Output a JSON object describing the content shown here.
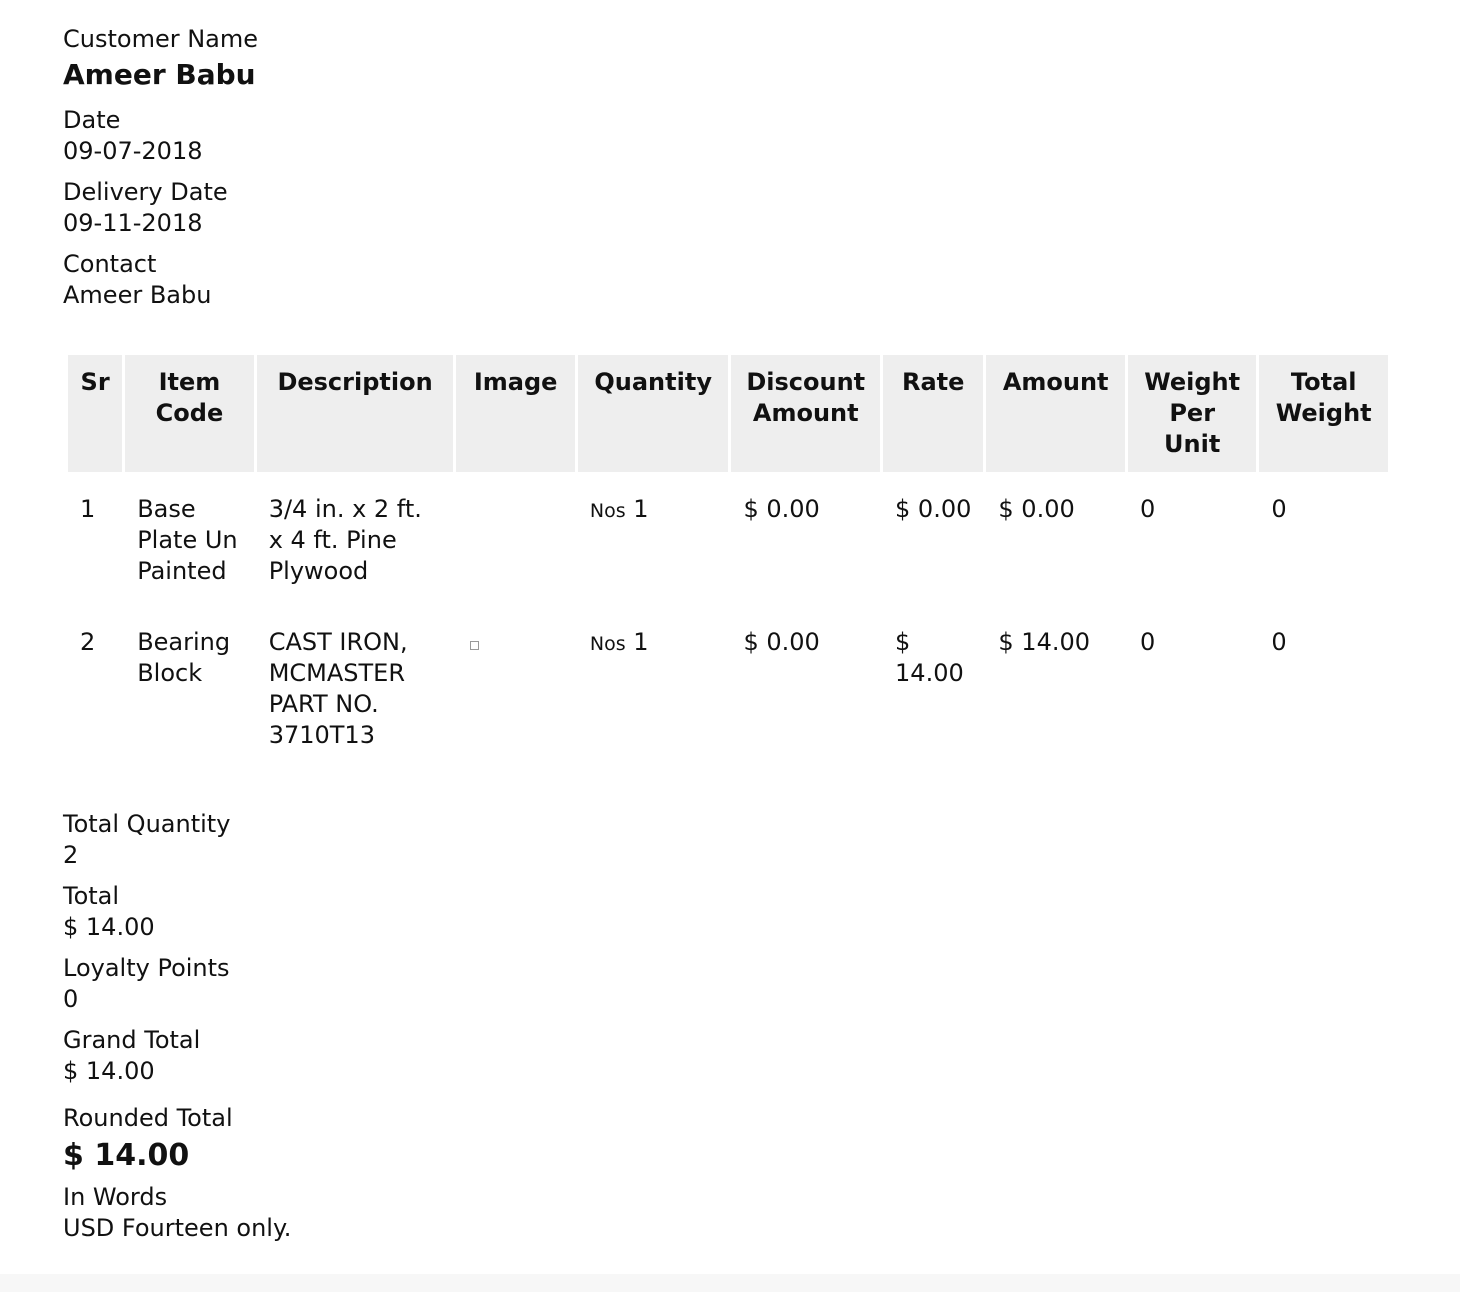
{
  "header": {
    "customer_label": "Customer Name",
    "customer_value": "Ameer Babu",
    "date_label": "Date",
    "date_value": "09-07-2018",
    "delivery_label": "Delivery Date",
    "delivery_value": "09-11-2018",
    "contact_label": "Contact",
    "contact_value": "Ameer Babu"
  },
  "table": {
    "columns": [
      "Sr",
      "Item Code",
      "Description",
      "Image",
      "Quantity",
      "Discount Amount",
      "Rate",
      "Amount",
      "Weight Per Unit",
      "Total Weight"
    ],
    "rows": [
      {
        "sr": "1",
        "item_code": "Base Plate Un Painted",
        "description": "3/4 in. x 2 ft. x 4 ft. Pine Plywood",
        "image": "",
        "uom": "Nos",
        "qty": "1",
        "discount": "$ 0.00",
        "rate": "$ 0.00",
        "amount": "$ 0.00",
        "weight_per_unit": "0",
        "total_weight": "0"
      },
      {
        "sr": "2",
        "item_code": "Bearing Block",
        "description": "CAST IRON, MCMASTER PART NO. 3710T13",
        "image": "broken-image-icon",
        "uom": "Nos",
        "qty": "1",
        "discount": "$ 0.00",
        "rate": "$ 14.00",
        "amount": "$ 14.00",
        "weight_per_unit": "0",
        "total_weight": "0"
      }
    ]
  },
  "totals": {
    "total_qty_label": "Total Quantity",
    "total_qty_value": "2",
    "total_label": "Total",
    "total_value": "$ 14.00",
    "loyalty_label": "Loyalty Points",
    "loyalty_value": "0",
    "grand_total_label": "Grand Total",
    "grand_total_value": "$ 14.00",
    "rounded_total_label": "Rounded Total",
    "rounded_total_value": "$ 14.00",
    "in_words_label": "In Words",
    "in_words_value": "USD Fourteen only."
  }
}
